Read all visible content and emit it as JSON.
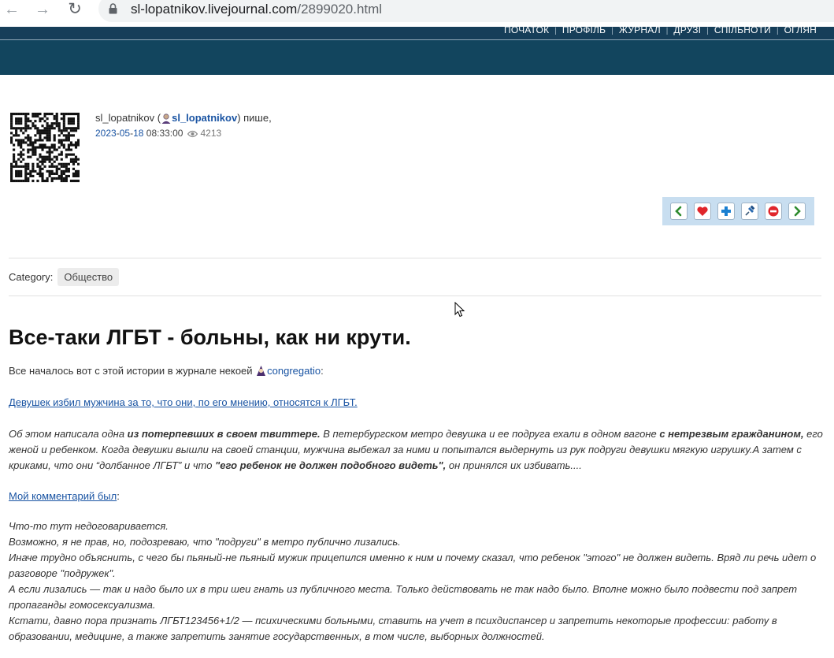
{
  "browser": {
    "url_domain": "sl-lopatnikov.livejournal.com",
    "url_path": "/2899020.html"
  },
  "nav": {
    "items": [
      "ПОЧАТОК",
      "ПРОФІЛЬ",
      "ЖУРНАЛ",
      "ДРУЗІ",
      "СПІЛЬНОТИ",
      "ОГЛЯН"
    ]
  },
  "author": {
    "name": "sl_lopatnikov",
    "open_paren": " (",
    "link": "sl_lopatnikov",
    "suffix": ") пише,"
  },
  "date": {
    "year": "2023",
    "month": "05",
    "day": "18",
    "time": "08:33:00",
    "views": "4213"
  },
  "toolbar": {
    "buttons": [
      "prev-arrow-icon",
      "heart-icon",
      "plus-icon",
      "pin-icon",
      "minus-icon",
      "next-arrow-icon"
    ]
  },
  "category": {
    "label": "Category:",
    "tag": "Общество"
  },
  "post": {
    "title": "Все-таки ЛГБТ - больны, как ни крути.",
    "intro_text": "Все началось вот с этой истории в журнале некоей ",
    "intro_user": "congregatio",
    "intro_end": ":",
    "story_link": "Девушек избил мужчина за то, что они, по его мнению, относятся к ЛГБТ.",
    "story": {
      "s1": "Об этом написала одна ",
      "b1": "из потерпевших в своем твиттере.",
      "s2": " В петербургском метро девушка и ее подруга ехали в одном вагоне ",
      "b2": "с нетрезвым гражданином,",
      "s3": " его женой и ребенком. Когда девушки вышли на своей станции, мужчина выбежал за ними и попытался выдернуть из рук подруги девушки мягкую игрушку.А затем с криками, что они “долбанное ЛГБТ” и что ",
      "b3": "\"его ребенок не должен подобного видеть\",",
      "s4": " он принялся их избивать...."
    },
    "comment_link": "Мой комментарий был",
    "comment_colon": ":",
    "comment_lines": [
      "Что-то тут недоговаривается.",
      "Возможно, я не прав, но, подозреваю, что \"подруги\" в метро публично лизались.",
      "Иначе трудно объяснить, с чего бы пьяный-не пьяный мужик прицепился именно к ним и почему сказал, что ребенок \"этого\" не должен видеть. Вряд ли речь идет о разговоре \"подружек\".",
      "А если лизались — так и надо было их в три шеи гнать из публичного места. Только действовать не так надо было. Вполне можно было подвести под запрет пропаганды гомосексуализма.",
      "Кстати, давно пора признать ЛГБТ123456+1/2 — психическими больными, ставить на учет в психдиспансер и запретить некоторые профессии: работу в образовании, медицине, а также запретить занятие государственных, в том числе, выборных должностей."
    ]
  }
}
